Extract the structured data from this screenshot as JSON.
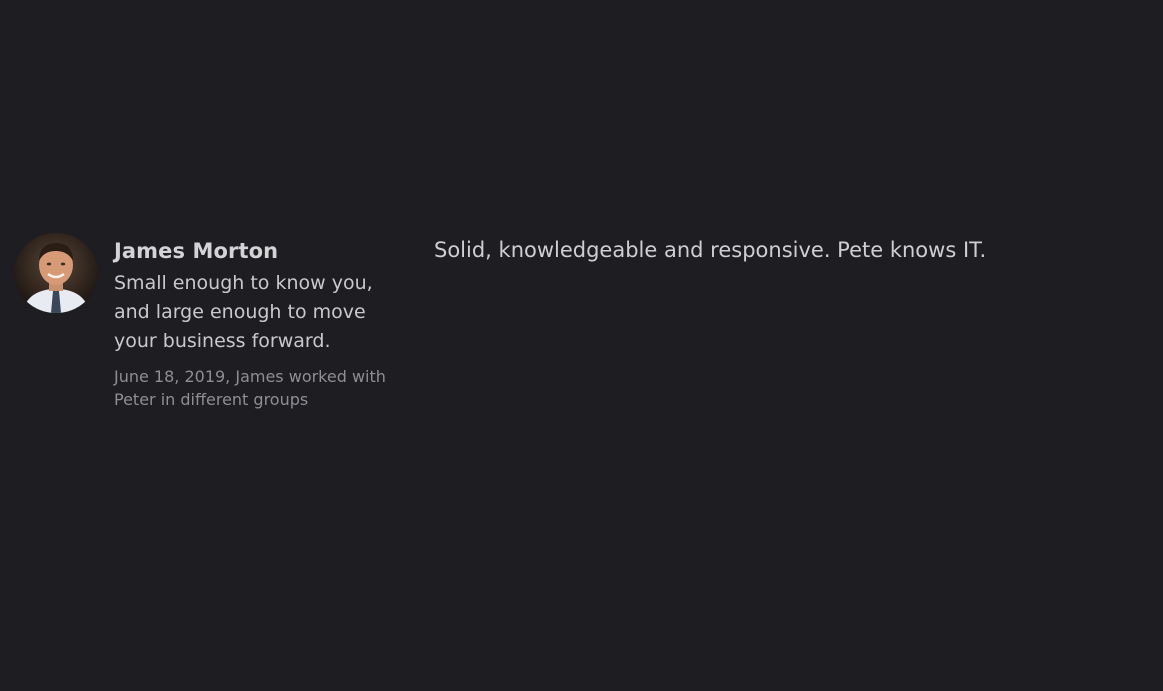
{
  "recommendation": {
    "recommender": {
      "name": "James Morton",
      "headline": "Small enough to know you, and large enough to move your business forward.",
      "meta": "June 18, 2019, James worked with Peter in different groups",
      "avatar_icon": "profile-photo"
    },
    "text": "Solid, knowledgeable and responsive. Pete knows IT."
  }
}
